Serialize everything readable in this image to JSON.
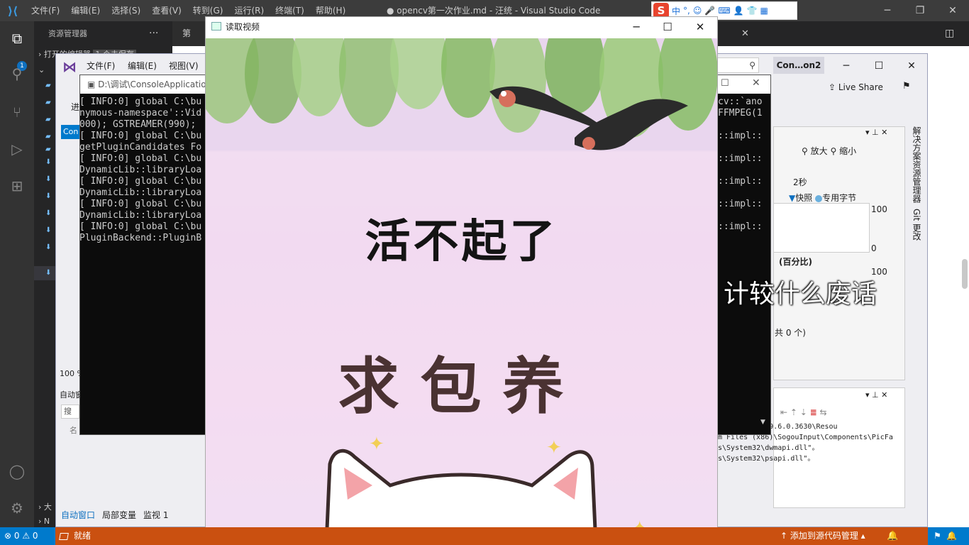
{
  "vscode": {
    "menu": [
      "文件(F)",
      "编辑(E)",
      "选择(S)",
      "查看(V)",
      "转到(G)",
      "运行(R)",
      "终端(T)",
      "帮助(H)"
    ],
    "window_title": "● opencv第一次作业.md - 汪统 - Visual Studio Code",
    "explorer_title": "资源管理器",
    "explorer_dots": "···",
    "open_editors": "打开的编辑器",
    "open_editors_badge": "1 个未保存",
    "explorer_badge": "1",
    "tab1_label": "第",
    "close_x": "✕",
    "split": "◫",
    "section_outline": "大",
    "section_timeline": "N"
  },
  "ime": {
    "logo": "S",
    "lang": "中",
    "punct": "°,"
  },
  "vs": {
    "menu": [
      "文件(F)",
      "编辑(E)",
      "视图(V)"
    ],
    "config": "Con…on2",
    "search_icon": "search-icon",
    "live_share": "Live Share",
    "left_label": "进",
    "left_ctrl": "Con",
    "zoom": "100 %",
    "auto_window_header": "自动窗",
    "search_placeholder": "搜索",
    "name_col": "名",
    "bottom_tabs": [
      "自动窗口",
      "局部变量",
      "监视 1"
    ],
    "side_tabs": [
      "解决方案资源管理器",
      "Git 更改"
    ],
    "diag": {
      "zoom_in": "放大",
      "zoom_out": "缩小",
      "time_label": "2秒",
      "legend_snapshot": "快照",
      "legend_bytes": "专用字节",
      "y_top": "100",
      "y_bottom": "0",
      "pct_header": "(百分比)",
      "y_top2": "100",
      "count": "共 0 个)"
    },
    "output_lines": [
      "\\SogouInput\\9.6.0.3630\\Resou",
      "m Files (x86)\\SogouInput\\Components\\PicFa",
      "s\\System32\\dwmapi.dll\"。",
      "s\\System32\\psapi.dll\"。"
    ]
  },
  "console": {
    "title": "D:\\调试\\ConsoleApplicatio",
    "left_lines": [
      "[ INFO:0] global C:\\bu",
      "nymous-namespace'::Vid",
      "000); GSTREAMER(990);",
      "[ INFO:0] global C:\\bu",
      "getPluginCandidates Fo",
      "[ INFO:0] global C:\\bu",
      "DynamicLib::libraryLoa",
      "[ INFO:0] global C:\\bu",
      "DynamicLib::libraryLoa",
      "[ INFO:0] global C:\\bu",
      "DynamicLib::libraryLoa",
      "[ INFO:0] global C:\\bu",
      "PluginBackend::PluginB"
    ],
    "right_lines": [
      "cv::`ano",
      "FFMPEG(1",
      "",
      "::impl::",
      "",
      "::impl::",
      "",
      "::impl::",
      "",
      "::impl::",
      "",
      "::impl::"
    ]
  },
  "video": {
    "window_title": "读取视频",
    "line1": "活不起了",
    "line2": "求包养"
  },
  "subtitle": "计较什么废话",
  "statusbar": {
    "problems": "⊗ 0 ⚠ 0",
    "ready": "就绪",
    "source_control": "↑ 添加到源代码管理 ▴",
    "bell": "🔔"
  }
}
